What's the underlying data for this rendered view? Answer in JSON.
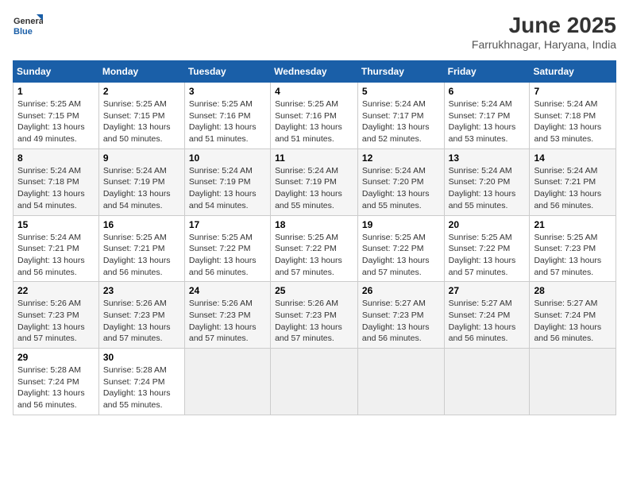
{
  "logo": {
    "general": "General",
    "blue": "Blue"
  },
  "title": "June 2025",
  "location": "Farrukhnagar, Haryana, India",
  "weekdays": [
    "Sunday",
    "Monday",
    "Tuesday",
    "Wednesday",
    "Thursday",
    "Friday",
    "Saturday"
  ],
  "weeks": [
    [
      {
        "day": "1",
        "info": "Sunrise: 5:25 AM\nSunset: 7:15 PM\nDaylight: 13 hours\nand 49 minutes."
      },
      {
        "day": "2",
        "info": "Sunrise: 5:25 AM\nSunset: 7:15 PM\nDaylight: 13 hours\nand 50 minutes."
      },
      {
        "day": "3",
        "info": "Sunrise: 5:25 AM\nSunset: 7:16 PM\nDaylight: 13 hours\nand 51 minutes."
      },
      {
        "day": "4",
        "info": "Sunrise: 5:25 AM\nSunset: 7:16 PM\nDaylight: 13 hours\nand 51 minutes."
      },
      {
        "day": "5",
        "info": "Sunrise: 5:24 AM\nSunset: 7:17 PM\nDaylight: 13 hours\nand 52 minutes."
      },
      {
        "day": "6",
        "info": "Sunrise: 5:24 AM\nSunset: 7:17 PM\nDaylight: 13 hours\nand 53 minutes."
      },
      {
        "day": "7",
        "info": "Sunrise: 5:24 AM\nSunset: 7:18 PM\nDaylight: 13 hours\nand 53 minutes."
      }
    ],
    [
      {
        "day": "8",
        "info": "Sunrise: 5:24 AM\nSunset: 7:18 PM\nDaylight: 13 hours\nand 54 minutes."
      },
      {
        "day": "9",
        "info": "Sunrise: 5:24 AM\nSunset: 7:19 PM\nDaylight: 13 hours\nand 54 minutes."
      },
      {
        "day": "10",
        "info": "Sunrise: 5:24 AM\nSunset: 7:19 PM\nDaylight: 13 hours\nand 54 minutes."
      },
      {
        "day": "11",
        "info": "Sunrise: 5:24 AM\nSunset: 7:19 PM\nDaylight: 13 hours\nand 55 minutes."
      },
      {
        "day": "12",
        "info": "Sunrise: 5:24 AM\nSunset: 7:20 PM\nDaylight: 13 hours\nand 55 minutes."
      },
      {
        "day": "13",
        "info": "Sunrise: 5:24 AM\nSunset: 7:20 PM\nDaylight: 13 hours\nand 55 minutes."
      },
      {
        "day": "14",
        "info": "Sunrise: 5:24 AM\nSunset: 7:21 PM\nDaylight: 13 hours\nand 56 minutes."
      }
    ],
    [
      {
        "day": "15",
        "info": "Sunrise: 5:24 AM\nSunset: 7:21 PM\nDaylight: 13 hours\nand 56 minutes."
      },
      {
        "day": "16",
        "info": "Sunrise: 5:25 AM\nSunset: 7:21 PM\nDaylight: 13 hours\nand 56 minutes."
      },
      {
        "day": "17",
        "info": "Sunrise: 5:25 AM\nSunset: 7:22 PM\nDaylight: 13 hours\nand 56 minutes."
      },
      {
        "day": "18",
        "info": "Sunrise: 5:25 AM\nSunset: 7:22 PM\nDaylight: 13 hours\nand 57 minutes."
      },
      {
        "day": "19",
        "info": "Sunrise: 5:25 AM\nSunset: 7:22 PM\nDaylight: 13 hours\nand 57 minutes."
      },
      {
        "day": "20",
        "info": "Sunrise: 5:25 AM\nSunset: 7:22 PM\nDaylight: 13 hours\nand 57 minutes."
      },
      {
        "day": "21",
        "info": "Sunrise: 5:25 AM\nSunset: 7:23 PM\nDaylight: 13 hours\nand 57 minutes."
      }
    ],
    [
      {
        "day": "22",
        "info": "Sunrise: 5:26 AM\nSunset: 7:23 PM\nDaylight: 13 hours\nand 57 minutes."
      },
      {
        "day": "23",
        "info": "Sunrise: 5:26 AM\nSunset: 7:23 PM\nDaylight: 13 hours\nand 57 minutes."
      },
      {
        "day": "24",
        "info": "Sunrise: 5:26 AM\nSunset: 7:23 PM\nDaylight: 13 hours\nand 57 minutes."
      },
      {
        "day": "25",
        "info": "Sunrise: 5:26 AM\nSunset: 7:23 PM\nDaylight: 13 hours\nand 57 minutes."
      },
      {
        "day": "26",
        "info": "Sunrise: 5:27 AM\nSunset: 7:23 PM\nDaylight: 13 hours\nand 56 minutes."
      },
      {
        "day": "27",
        "info": "Sunrise: 5:27 AM\nSunset: 7:24 PM\nDaylight: 13 hours\nand 56 minutes."
      },
      {
        "day": "28",
        "info": "Sunrise: 5:27 AM\nSunset: 7:24 PM\nDaylight: 13 hours\nand 56 minutes."
      }
    ],
    [
      {
        "day": "29",
        "info": "Sunrise: 5:28 AM\nSunset: 7:24 PM\nDaylight: 13 hours\nand 56 minutes."
      },
      {
        "day": "30",
        "info": "Sunrise: 5:28 AM\nSunset: 7:24 PM\nDaylight: 13 hours\nand 55 minutes."
      },
      {
        "day": "",
        "info": ""
      },
      {
        "day": "",
        "info": ""
      },
      {
        "day": "",
        "info": ""
      },
      {
        "day": "",
        "info": ""
      },
      {
        "day": "",
        "info": ""
      }
    ]
  ]
}
